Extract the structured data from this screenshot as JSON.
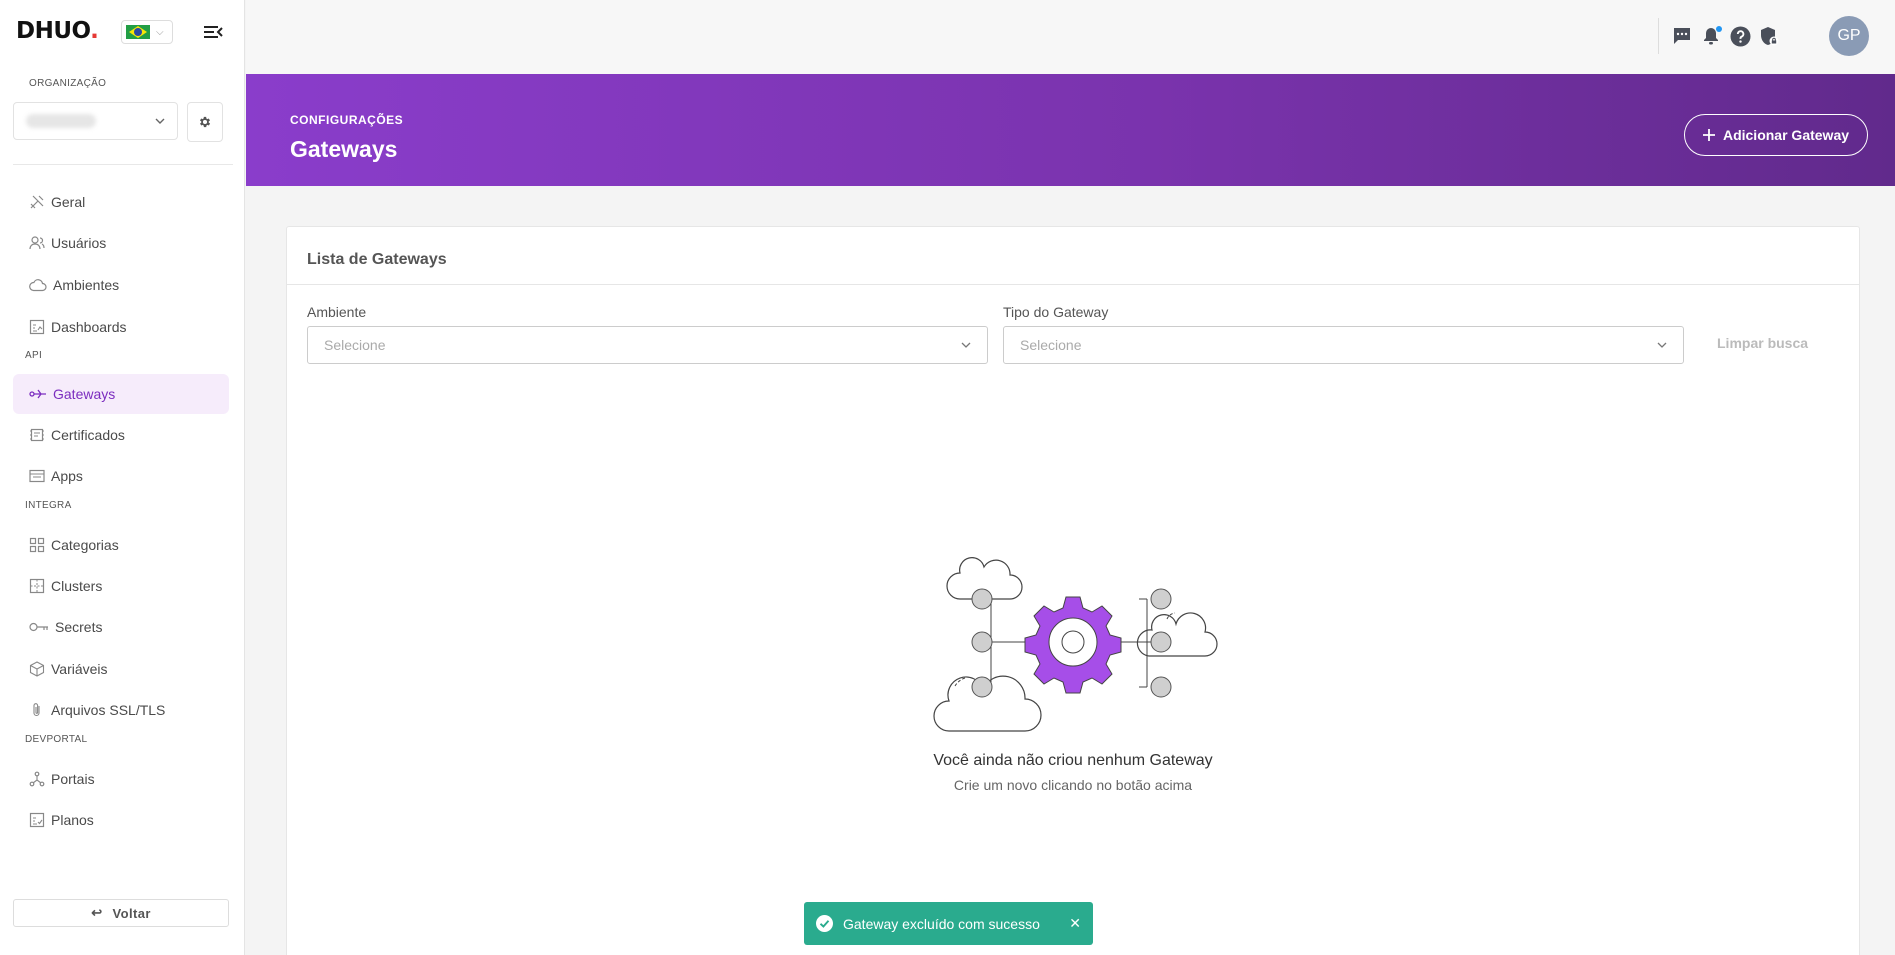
{
  "brand": {
    "logo_text": "DHUO",
    "logo_dot": "."
  },
  "header": {
    "avatar_initials": "GP"
  },
  "sidebar": {
    "org_label": "ORGANIZAÇÃO",
    "sections": {
      "api": "API",
      "integra": "INTEGRA",
      "devportal": "DEVPORTAL"
    },
    "items": [
      {
        "label": "Geral",
        "icon": "tools-icon"
      },
      {
        "label": "Usuários",
        "icon": "users-icon"
      },
      {
        "label": "Ambientes",
        "icon": "cloud-icon"
      },
      {
        "label": "Dashboards",
        "icon": "dashboard-icon"
      },
      {
        "label": "Gateways",
        "icon": "gateway-icon",
        "active": true
      },
      {
        "label": "Certificados",
        "icon": "certificate-icon"
      },
      {
        "label": "Apps",
        "icon": "apps-icon"
      },
      {
        "label": "Categorias",
        "icon": "categories-icon"
      },
      {
        "label": "Clusters",
        "icon": "clusters-icon"
      },
      {
        "label": "Secrets",
        "icon": "key-icon"
      },
      {
        "label": "Variáveis",
        "icon": "cube-icon"
      },
      {
        "label": "Arquivos SSL/TLS",
        "icon": "paperclip-icon"
      },
      {
        "label": "Portais",
        "icon": "portal-icon"
      },
      {
        "label": "Planos",
        "icon": "plans-icon"
      }
    ],
    "back_label": "Voltar"
  },
  "banner": {
    "subtitle": "CONFIGURAÇÕES",
    "title": "Gateways",
    "add_button_label": "Adicionar Gateway"
  },
  "list": {
    "title": "Lista de Gateways",
    "filters": {
      "ambiente_label": "Ambiente",
      "ambiente_placeholder": "Selecione",
      "tipo_label": "Tipo do Gateway",
      "tipo_placeholder": "Selecione",
      "clear_label": "Limpar busca"
    },
    "empty": {
      "title": "Você ainda não criou nenhum Gateway",
      "subtitle": "Crie um novo clicando no botão acima"
    }
  },
  "toast": {
    "message": "Gateway excluído com sucesso"
  },
  "colors": {
    "accent": "#7b2cbf",
    "banner_start": "#8a3dcb",
    "banner_end": "#612a8c",
    "toast": "#2aab8e",
    "gear": "#a64ee8"
  }
}
